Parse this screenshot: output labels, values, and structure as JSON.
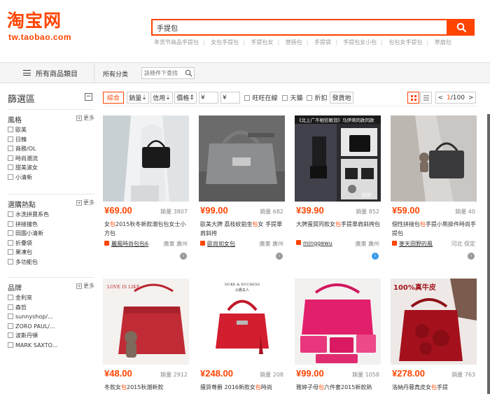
{
  "header": {
    "logo_text": "淘宝网",
    "logo_url": "tw.taobao.com",
    "search_value": "手提包",
    "search_icon": "magnifier-icon"
  },
  "hot_words": [
    "年货节商品手提包",
    "女包手提包",
    "手提包女",
    "营扬包",
    "手提袋",
    "手提包女小包",
    "包包女手提包",
    "草扇包"
  ],
  "category_bar": {
    "all_categories": "所有商品類目",
    "breadcrumb": "所有分类",
    "in_search_placeholder": "該條件下查找"
  },
  "sidebar": {
    "title": "篩選區",
    "collapse": "−",
    "more_label": "更多",
    "sections": [
      {
        "title": "風格",
        "items": [
          "歐美",
          "日韓",
          "商務/OL",
          "時尚潮流",
          "甜美淑女",
          "小清新"
        ]
      },
      {
        "title": "選購熱點",
        "items": [
          "水洗拼異系色",
          "拼接撞色",
          "田園小清新",
          "折疊袋",
          "果凍包",
          "多功能包"
        ]
      },
      {
        "title": "品牌",
        "items": [
          "金利來",
          "森哲",
          "sunnyshop/...",
          "ZORO PAUL/...",
          "波斯丹頓",
          "MARK SAXTO..."
        ]
      }
    ]
  },
  "sort_bar": {
    "items": [
      "綜合",
      "銷量",
      "信用",
      "價格"
    ],
    "price_from": "¥",
    "price_to": "¥",
    "checks": [
      "旺旺在線",
      "天貓",
      "折扣"
    ],
    "ship_to": "發貨地",
    "pager": {
      "prev": "<",
      "current": "1",
      "total": "/100",
      "next": ">"
    }
  },
  "products": [
    {
      "price": "¥69.00",
      "sales": "銷量 3807",
      "title_pre": "女",
      "title_em": "包",
      "title_post": "2015秋冬新款潮包包女士小方包",
      "shop": "麗風時尚包包6",
      "loc": "廣東 廣州",
      "wang": "blue-false"
    },
    {
      "price": "¥99.00",
      "sales": "銷量 682",
      "title_pre": "歐美大牌 荔枝紋鉑金",
      "title_em": "包",
      "title_post": "女 手提單肩斜挎",
      "shop": "歐尚如女包",
      "loc": "廣東 廣州",
      "wang": "blue-false"
    },
    {
      "price": "¥39.90",
      "sales": "銷量 852",
      "title_pre": "大牌蛋質同款女",
      "title_em": "包",
      "title_post": "手提單肩斜挎包",
      "shop": "minggewu",
      "loc": "廣東 廣州",
      "wang": "blue-true"
    },
    {
      "price": "¥59.00",
      "sales": "銷量 40",
      "title_pre": "個性拼接包",
      "title_em": "包",
      "title_post": "手提小熊掛件時尚手提包",
      "shop": "麥天田野的風",
      "loc": "河北 保定",
      "wang": "blue-false"
    },
    {
      "price": "¥48.00",
      "sales": "銷量 2912",
      "title_pre": "冬款女",
      "title_em": "包",
      "title_post": "2015秋潮新款",
      "shop": "",
      "loc": "",
      "wang": ""
    },
    {
      "price": "¥248.00",
      "sales": "銷量 208",
      "title_pre": "擅貨尊爵 2016新款女",
      "title_em": "包",
      "title_post": "時尚",
      "shop": "",
      "loc": "",
      "wang": ""
    },
    {
      "price": "¥99.00",
      "sales": "銷量 1058",
      "title_pre": "雅婷子母",
      "title_em": "包",
      "title_post": "六件套2015新款熱",
      "shop": "",
      "loc": "",
      "wang": ""
    },
    {
      "price": "¥278.00",
      "sales": "銷量 763",
      "title_pre": "洛納丹蓉真皮女",
      "title_em": "包",
      "title_post": "手提",
      "shop": "",
      "loc": "",
      "wang": ""
    }
  ],
  "image_texts": {
    "p3_banner": "《北上广不相信眼泪》马伊琍同款同款",
    "p3_corner": "你好",
    "p5_brand": "LOVE IS LIKE",
    "p6_brand": "DUKE & DUCHESS",
    "p6_brand_cn": "公爵夫人",
    "p8_brand": "100%真牛皮"
  },
  "colors": {
    "accent": "#ff4400"
  }
}
